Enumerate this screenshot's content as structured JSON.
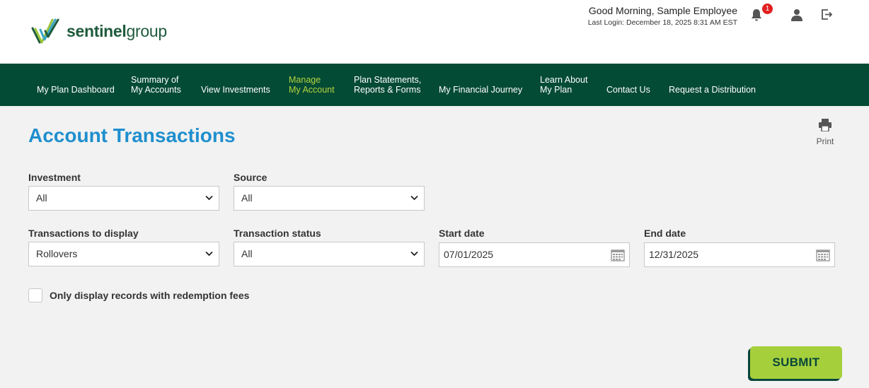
{
  "logo": {
    "text_bold": "sentinel",
    "text_light": "group"
  },
  "header": {
    "greeting": "Good Morning,  Sample Employee",
    "last_login": "Last Login: December 18, 2025 8:31 AM EST",
    "notification_count": "1"
  },
  "nav": {
    "items": [
      {
        "line1": "",
        "line2": "My Plan Dashboard"
      },
      {
        "line1": "Summary of",
        "line2": "My Accounts"
      },
      {
        "line1": "",
        "line2": "View Investments"
      },
      {
        "line1": "Manage",
        "line2": "My Account"
      },
      {
        "line1": "Plan Statements,",
        "line2": "Reports & Forms"
      },
      {
        "line1": "",
        "line2": "My Financial Journey"
      },
      {
        "line1": "Learn About",
        "line2": "My Plan"
      },
      {
        "line1": "",
        "line2": "Contact Us"
      },
      {
        "line1": "",
        "line2": "Request a Distribution"
      }
    ],
    "active_color": "#b5d33e"
  },
  "page": {
    "title": "Account Transactions",
    "print_label": "Print"
  },
  "form": {
    "investment": {
      "label": "Investment",
      "value": "All"
    },
    "source": {
      "label": "Source",
      "value": "All"
    },
    "transactions_to_display": {
      "label": "Transactions to display",
      "value": "Rollovers"
    },
    "transaction_status": {
      "label": "Transaction status",
      "value": "All"
    },
    "start_date": {
      "label": "Start date",
      "value": "07/01/2025"
    },
    "end_date": {
      "label": "End date",
      "value": "12/31/2025"
    },
    "redemption_checkbox": {
      "label": "Only display records with redemption fees",
      "checked": false
    },
    "submit_label": "SUBMIT"
  },
  "colors": {
    "nav_bg": "#044b35",
    "title": "#1f8fce",
    "submit_bg": "#a6cf3c",
    "badge": "#e02020"
  },
  "icons": {
    "notification": "bell-icon",
    "profile": "user-icon",
    "logout": "logout-icon",
    "print": "printer-icon",
    "calendar": "calendar-icon",
    "dropdown": "chevron-down-icon"
  }
}
